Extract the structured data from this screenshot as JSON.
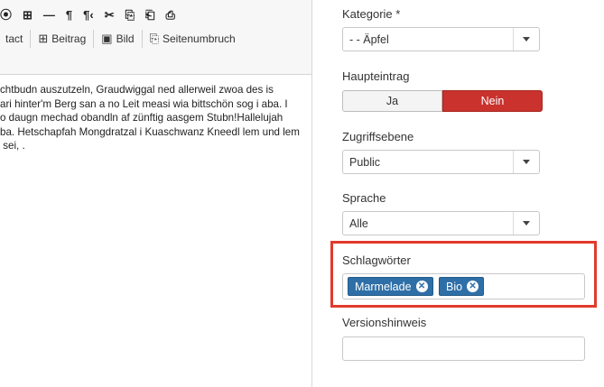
{
  "toolbar": {
    "row1_icons": [
      "⦿",
      "⊞",
      "—",
      "¶",
      "¶‹",
      "✂",
      "⎘",
      "⎗",
      "⎙"
    ],
    "contact_label": "tact",
    "beitrag_label": "Beitrag",
    "bild_label": "Bild",
    "seitenumbruch_label": "Seitenumbruch"
  },
  "editor": {
    "lines": [
      "chtbudn auszutzeln, Graudwiggal ned allerweil zwoa des is",
      "ari hinter'm Berg san a no Leit measi wia bittschön sog i aba. I",
      "o daugn mechad obandln af zünftig aasgem Stubn!Hallelujah",
      "ba. Hetschapfah Mongdratzal i Kuaschwanz Kneedl lem und lem",
      " sei, ."
    ]
  },
  "fields": {
    "kategorie": {
      "label": "Kategorie *",
      "value": "- - Äpfel"
    },
    "haupteintrag": {
      "label": "Haupteintrag",
      "yes": "Ja",
      "no": "Nein",
      "selected": "Nein"
    },
    "zugriffsebene": {
      "label": "Zugriffsebene",
      "value": "Public"
    },
    "sprache": {
      "label": "Sprache",
      "value": "Alle"
    },
    "schlagwoerter": {
      "label": "Schlagwörter",
      "tags": [
        "Marmelade",
        "Bio"
      ]
    },
    "versionshinweis": {
      "label": "Versionshinweis",
      "value": ""
    }
  },
  "colors": {
    "tag_blue": "#2f6fa7",
    "no_red": "#c9322d",
    "highlight_red": "#e23a2a"
  }
}
